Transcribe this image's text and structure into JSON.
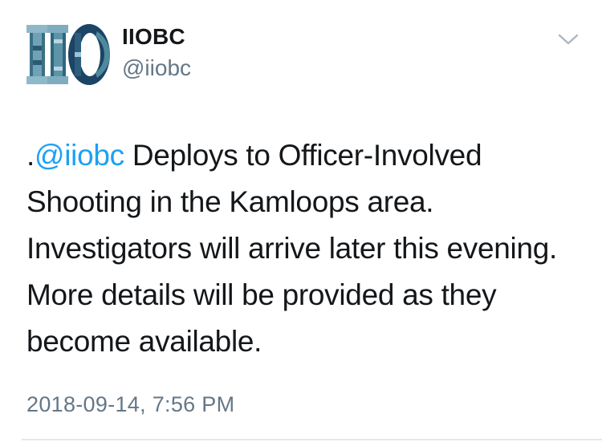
{
  "tweet": {
    "author": {
      "display_name": "IIOBC",
      "handle": "@iiobc",
      "avatar_logo_text": "IIO"
    },
    "body": {
      "prefix": ".",
      "mention": "@iiobc",
      "text": " Deploys to Officer-Involved Shooting in the Kamloops area. Investigators will arrive later this evening. More details will be provided as they become available."
    },
    "timestamp": "2018-09-14, 7:56 PM",
    "menu_icon": "chevron-down-icon"
  },
  "colors": {
    "text_primary": "#14171a",
    "text_secondary": "#657786",
    "link": "#1da1f2",
    "divider": "#e1e8ed",
    "logo_dark": "#1c4466",
    "logo_teal": "#4e8a9c",
    "logo_light": "#9cc3d1"
  }
}
